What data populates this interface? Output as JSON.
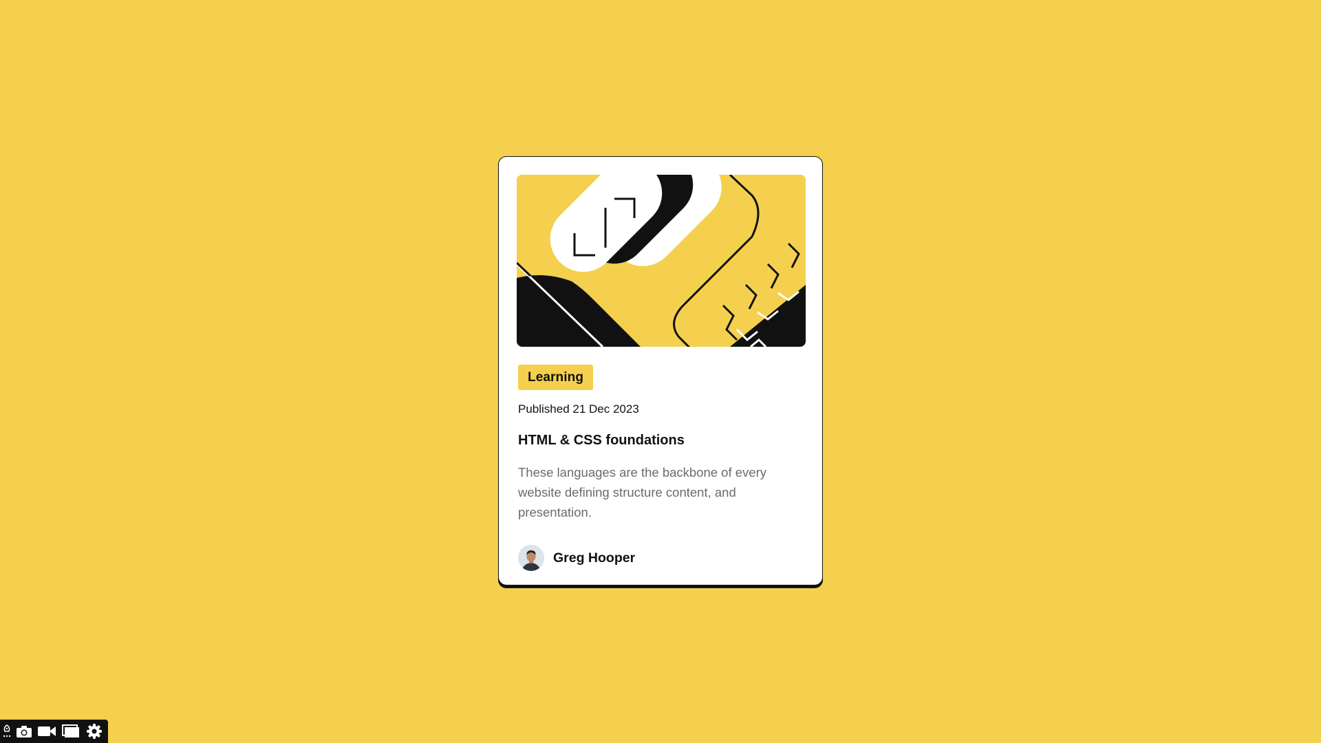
{
  "card": {
    "tag": "Learning",
    "published": "Published 21 Dec 2023",
    "title": "HTML & CSS foundations",
    "description": "These languages are the backbone of every website defining structure content, and presentation.",
    "author": {
      "name": "Greg Hooper",
      "avatar_icon": "avatar-portrait"
    },
    "hero_icon": "code-brackets-illustration"
  },
  "toolbar": {
    "icons": [
      "rocket-icon",
      "camera-icon",
      "video-icon",
      "window-icon",
      "gear-icon"
    ]
  },
  "colors": {
    "background": "#F4D04E",
    "card": "#FFFFFF",
    "ink": "#111111",
    "muted_text": "#6B6B6B",
    "toolbar": "#111111"
  }
}
